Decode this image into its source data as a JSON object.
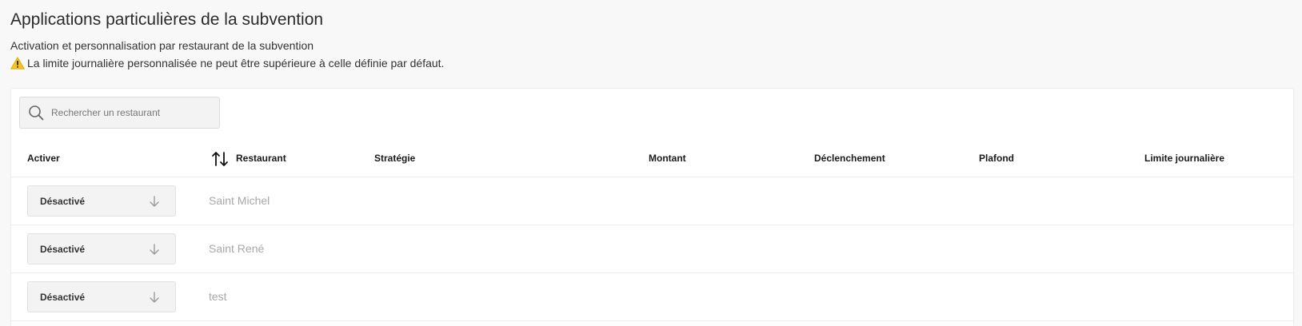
{
  "header": {
    "title": "Applications particulières de la subvention",
    "subtitle": "Activation et personnalisation par restaurant de la subvention",
    "warning": "La limite journalière personnalisée ne peut être supérieure à celle définie par défaut."
  },
  "search": {
    "placeholder": "Rechercher un restaurant",
    "value": ""
  },
  "table": {
    "columns": {
      "activer": "Activer",
      "restaurant": "Restaurant",
      "strategie": "Stratégie",
      "montant": "Montant",
      "declenchement": "Déclenchement",
      "plafond": "Plafond",
      "limite": "Limite journalière"
    },
    "rows": [
      {
        "status": "Désactivé",
        "restaurant": "Saint Michel"
      },
      {
        "status": "Désactivé",
        "restaurant": "Saint René"
      },
      {
        "status": "Désactivé",
        "restaurant": "test"
      }
    ]
  },
  "icons": {
    "warning": "warning-icon",
    "search": "search-icon",
    "sort": "sort-icon",
    "select_arrow": "arrow-down-icon"
  },
  "colors": {
    "page_background": "#f8f8f8",
    "card_background": "#ffffff",
    "input_background": "#f3f3f3",
    "warning_yellow": "#f5c518",
    "muted_text": "#a8a8a8"
  }
}
